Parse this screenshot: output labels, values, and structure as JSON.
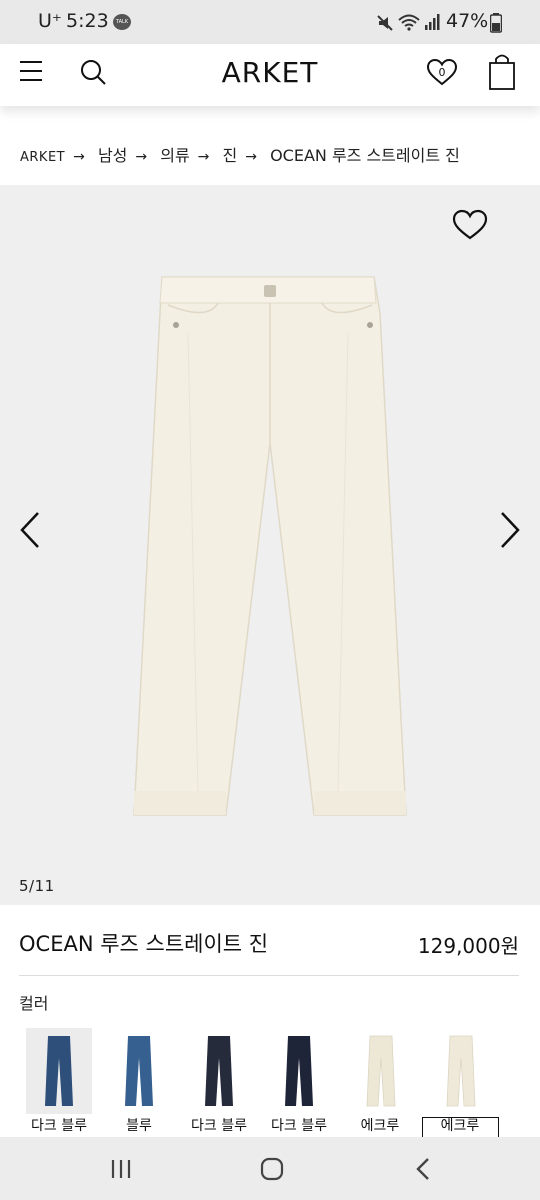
{
  "status_bar": {
    "carrier": "U⁺",
    "time": "5:23",
    "talk_badge": "TALK",
    "battery": "47%"
  },
  "header": {
    "logo": "ARKET",
    "wishlist_count": "0"
  },
  "breadcrumb": [
    "ARKET",
    "남성",
    "의류",
    "진",
    "OCEAN 루즈 스트레이트 진"
  ],
  "gallery": {
    "counter": "5/11"
  },
  "product": {
    "name": "OCEAN 루즈 스트레이트 진",
    "price": "129,000원"
  },
  "colors": {
    "label": "컬러",
    "options": [
      {
        "label": "다크 블루",
        "color": "#2e4f7a"
      },
      {
        "label": "블루",
        "color": "#36608f"
      },
      {
        "label": "다크 블루",
        "color": "#262b3c"
      },
      {
        "label": "다크 블루",
        "color": "#1f2538"
      },
      {
        "label": "에크루",
        "color": "#ede7d6"
      },
      {
        "label": "에크루",
        "color": "#efe9da"
      }
    ],
    "selected_index": 5
  },
  "icons": {
    "menu": "menu-icon",
    "search": "search-icon",
    "wishlist": "heart-icon",
    "bag": "bag-icon",
    "prev": "chevron-left-icon",
    "next": "chevron-right-icon",
    "nav_recents": "recents-icon",
    "nav_home": "home-icon",
    "nav_back": "back-icon"
  }
}
